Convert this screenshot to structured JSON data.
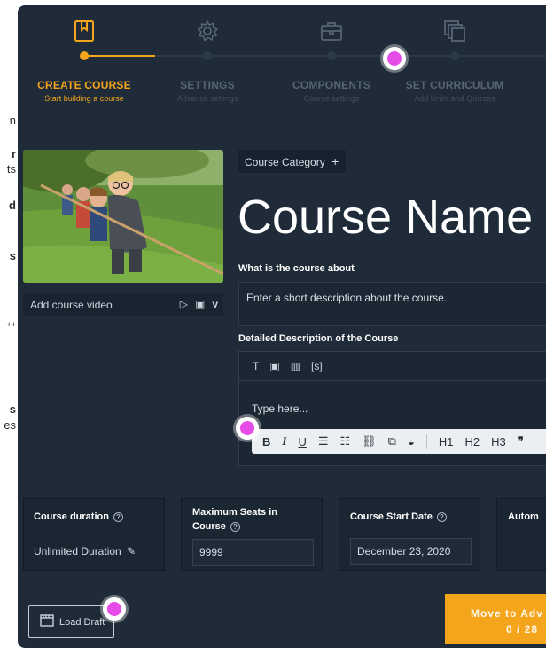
{
  "left_edge": {
    "fragments": [
      {
        "text": "n",
        "bold": false
      },
      {
        "text": "r",
        "bold": true
      },
      {
        "text": "ts",
        "bold": false
      },
      {
        "text": "d",
        "bold": true
      },
      {
        "text": "s",
        "bold": true
      },
      {
        "text": "++",
        "bold": false
      },
      {
        "text": "s",
        "bold": true
      },
      {
        "text": "es",
        "bold": false
      }
    ]
  },
  "steps": [
    {
      "title": "CREATE COURSE",
      "subtitle": "Start building a course",
      "icon": "bookmark-icon",
      "active": true
    },
    {
      "title": "SETTINGS",
      "subtitle": "Advance settings",
      "icon": "gear-icon",
      "active": false
    },
    {
      "title": "COMPONENTS",
      "subtitle": "Course settings",
      "icon": "briefcase-icon",
      "active": false
    },
    {
      "title": "SET CURRICULUM",
      "subtitle": "Add Units and Quizzes",
      "icon": "layers-icon",
      "active": false
    }
  ],
  "course": {
    "category_label": "Course Category",
    "category_plus": "+",
    "name": "Course Name",
    "about_label": "What is the course about",
    "about_placeholder": "Enter a short description about the course.",
    "video_label": "Add course video",
    "video_icons": [
      "play-icon",
      "youtube-icon",
      "vimeo-icon"
    ],
    "detailed_label": "Detailed Description of the Course",
    "editor_tools": [
      "T",
      "▣",
      "▥",
      "[s]"
    ],
    "editor_placeholder": "Type here...",
    "format_tools": [
      "B",
      "I",
      "U",
      "☰",
      "☷",
      "⛓",
      "⧉",
      "◒",
      "H1",
      "H2",
      "H3",
      "❞"
    ]
  },
  "cards": {
    "duration": {
      "label": "Course duration",
      "help": "?",
      "value": "Unlimited Duration",
      "edit_icon": "pencil-icon"
    },
    "seats": {
      "label": "Maximum Seats in Course",
      "help": "?",
      "value": "9999"
    },
    "start_date": {
      "label": "Course Start Date",
      "help": "?",
      "value": "December 23, 2020"
    },
    "auto": {
      "label": "Autom"
    }
  },
  "footer": {
    "load_draft": "Load Draft",
    "advance_line1": "Move to Adv",
    "advance_line2": "0 / 28"
  },
  "colors": {
    "panel": "#1f2b38",
    "accent": "#f4a51c",
    "highlight": "#e84ce8"
  }
}
